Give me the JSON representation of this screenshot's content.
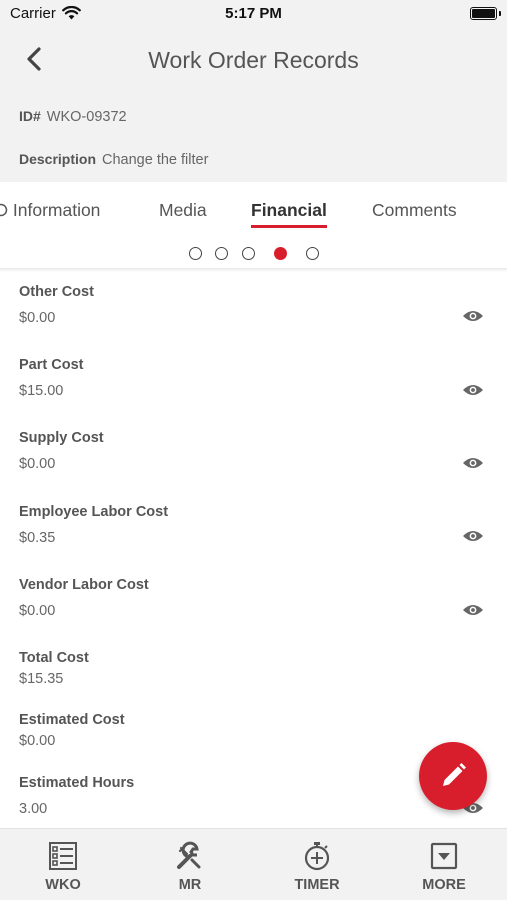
{
  "status_bar": {
    "carrier": "Carrier",
    "time": "5:17 PM"
  },
  "nav": {
    "title": "Work Order Records",
    "back_icon": "chevron-left-icon"
  },
  "summary": {
    "id_label": "ID#",
    "id_value": "WKO-09372",
    "description_label": "Description",
    "description_value": "Change the filter"
  },
  "tabs": [
    {
      "label": "Information",
      "icon": "circle-icon"
    },
    {
      "label": "Media"
    },
    {
      "label": "Financial",
      "active": true
    },
    {
      "label": "Comments"
    }
  ],
  "page_indicator": {
    "pages": 5,
    "active_index": 3
  },
  "fields": [
    {
      "label": "Other Cost",
      "value": "$0.00",
      "has_eye": true
    },
    {
      "label": "Part Cost",
      "value": "$15.00",
      "has_eye": true
    },
    {
      "label": "Supply Cost",
      "value": "$0.00",
      "has_eye": true
    },
    {
      "label": "Employee Labor Cost",
      "value": "$0.35",
      "has_eye": true
    },
    {
      "label": "Vendor Labor Cost",
      "value": "$0.00",
      "has_eye": true
    },
    {
      "label": "Total Cost",
      "value": "$15.35",
      "has_eye": false
    },
    {
      "label": "Estimated Cost",
      "value": "$0.00",
      "has_eye": false
    },
    {
      "label": "Estimated Hours",
      "value": "3.00",
      "has_eye": true
    }
  ],
  "fab": {
    "icon": "pencil-icon"
  },
  "bottom_nav": [
    {
      "label": "WKO",
      "icon": "list-icon"
    },
    {
      "label": "MR",
      "icon": "wrench-icon"
    },
    {
      "label": "TIMER",
      "icon": "stopwatch-icon"
    },
    {
      "label": "MORE",
      "icon": "dropdown-box-icon"
    }
  ],
  "colors": {
    "accent": "#d81e2c",
    "background": "#f2f2f2",
    "text": "#555555"
  }
}
